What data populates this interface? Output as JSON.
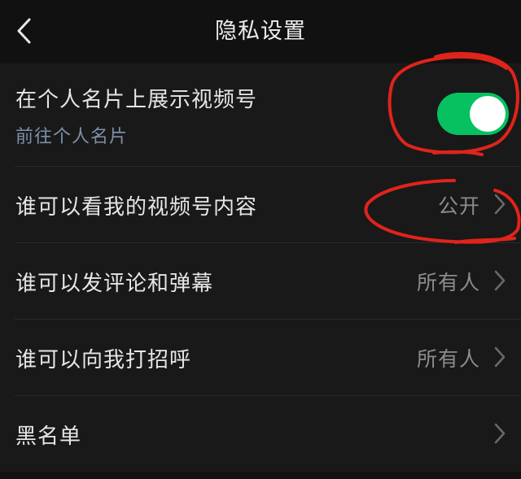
{
  "header": {
    "title": "隐私设置",
    "back_icon": "chevron-left-icon"
  },
  "settings": {
    "show_channel": {
      "label": "在个人名片上展示视频号",
      "sub_link": "前往个人名片",
      "toggle_on": true
    },
    "who_can_view": {
      "label": "谁可以看我的视频号内容",
      "value": "公开"
    },
    "who_can_comment": {
      "label": "谁可以发评论和弹幕",
      "value": "所有人"
    },
    "who_can_greet": {
      "label": "谁可以向我打招呼",
      "value": "所有人"
    },
    "blacklist": {
      "label": "黑名单",
      "value": ""
    }
  },
  "colors": {
    "background": "#111111",
    "row_background": "#191919",
    "toggle_on": "#07c160",
    "link": "#7d90a9",
    "value_text": "#8c8c8c",
    "annotation": "#e0241b"
  }
}
